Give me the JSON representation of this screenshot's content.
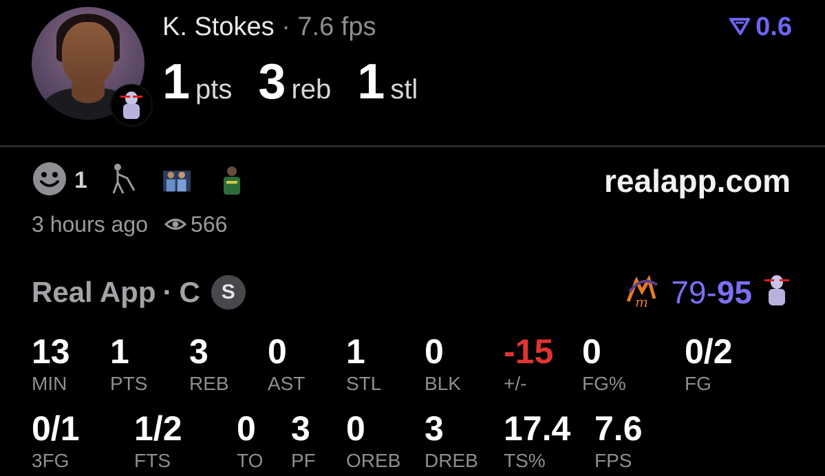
{
  "player": {
    "name": "K. Stokes",
    "separator": "·",
    "fps_label": "7.6 fps"
  },
  "headline_stats": [
    {
      "value": "1",
      "unit": "pts"
    },
    {
      "value": "3",
      "unit": "reb"
    },
    {
      "value": "1",
      "unit": "stl"
    }
  ],
  "rating": {
    "value": "0.6",
    "icon": "v-arrow-icon"
  },
  "reactions": {
    "count": "1",
    "site": "realapp.com",
    "time_ago": "3 hours ago",
    "views": "566"
  },
  "game": {
    "app_name": "Real App",
    "separator": "·",
    "position": "C",
    "chip_label": "S",
    "score_left": "79",
    "score_dash": "-",
    "score_right": "95"
  },
  "stats_row1": [
    {
      "value": "13",
      "label": "MIN"
    },
    {
      "value": "1",
      "label": "PTS"
    },
    {
      "value": "3",
      "label": "REB"
    },
    {
      "value": "0",
      "label": "AST"
    },
    {
      "value": "1",
      "label": "STL"
    },
    {
      "value": "0",
      "label": "BLK"
    },
    {
      "value": "-15",
      "label": "+/-"
    },
    {
      "value": "0",
      "label": "FG%"
    },
    {
      "value": "0/2",
      "label": "FG"
    }
  ],
  "stats_row2": [
    {
      "value": "0/1",
      "label": "3FG"
    },
    {
      "value": "1/2",
      "label": "FTS"
    },
    {
      "value": "0",
      "label": "TO"
    },
    {
      "value": "3",
      "label": "PF"
    },
    {
      "value": "0",
      "label": "OREB"
    },
    {
      "value": "3",
      "label": "DREB"
    },
    {
      "value": "17.4",
      "label": "TS%"
    },
    {
      "value": "7.6",
      "label": "FPS"
    }
  ],
  "colors": {
    "accent": "#6f64f5",
    "negative": "#e0342f",
    "muted": "#8e8e93"
  }
}
